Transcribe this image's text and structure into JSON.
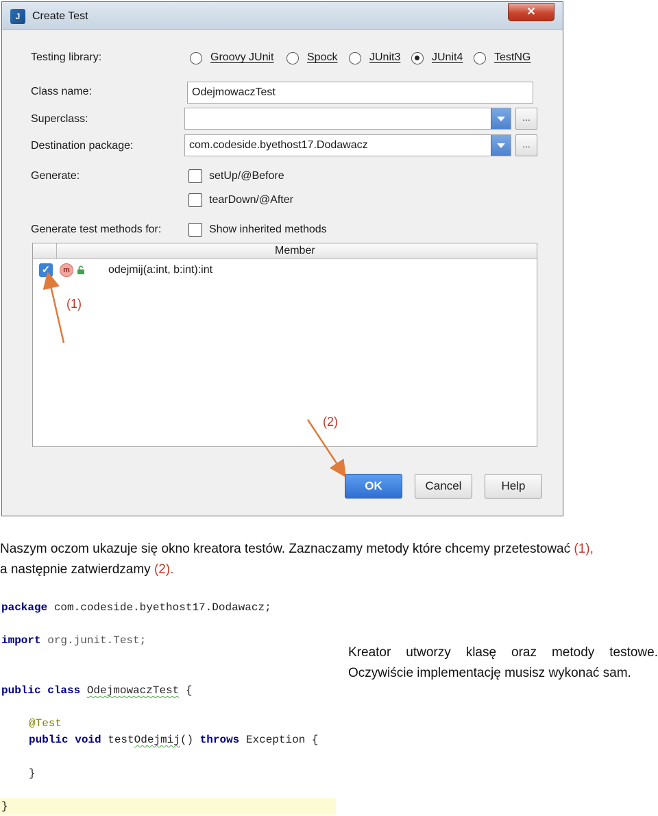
{
  "dialog": {
    "title": "Create Test",
    "close_label": "✕",
    "app_icon_label": "J",
    "testing_library": {
      "label": "Testing library:",
      "options": [
        {
          "label": "Groovy JUnit",
          "selected": false
        },
        {
          "label": "Spock",
          "selected": false
        },
        {
          "label": "JUnit3",
          "selected": false
        },
        {
          "label": "JUnit4",
          "selected": true
        },
        {
          "label": "TestNG",
          "selected": false
        }
      ]
    },
    "class_name": {
      "label": "Class name:",
      "value": "OdejmowaczTest"
    },
    "superclass": {
      "label": "Superclass:",
      "value": ""
    },
    "destination_package": {
      "label": "Destination package:",
      "value": "com.codeside.byethost17.Dodawacz"
    },
    "ellipsis_label": "...",
    "generate": {
      "label": "Generate:",
      "options": [
        {
          "label": "setUp/@Before",
          "checked": false
        },
        {
          "label": "tearDown/@After",
          "checked": false
        }
      ]
    },
    "generate_methods_for": {
      "label": "Generate test methods for:",
      "show_inherited_label": "Show inherited methods",
      "checked": false
    },
    "table": {
      "column_header": "Member",
      "rows": [
        {
          "checked": true,
          "icon_label": "m",
          "member": "odejmij(a:int, b:int):int"
        }
      ]
    },
    "buttons": {
      "ok": "OK",
      "cancel": "Cancel",
      "help": "Help"
    },
    "annotations": {
      "one": "(1)",
      "two": "(2)"
    },
    "accent_color": "#2f6fd1",
    "annotation_color": "#c0392b"
  },
  "prose": {
    "line1_text": "Naszym oczom ukazuje się okno kreatora testów. Zaznaczamy metody które chcemy przetestować ",
    "line1_ref": "(1),",
    "line2_text": "a następnie zatwierdzamy ",
    "line2_ref": "(2)."
  },
  "code": {
    "pkg_kw": "package",
    "pkg_name": " com.codeside.byethost17.Dodawacz;",
    "import_kw": "import",
    "import_name": " org.junit.Test;",
    "class_kw": "public class",
    "class_name": "OdejmowaczTest",
    "class_brace": " {",
    "annotation": "@Test",
    "method_kw": "public void",
    "method_prefix": " test",
    "method_squiggle": "Odejmij",
    "method_suffix": "()",
    "throws_kw": "throws",
    "exception": " Exception {",
    "close_inner": "}",
    "close_outer": "}"
  },
  "side_text": "Kreator utworzy klasę oraz metody testowe. Oczywiście implementację musisz wykonać sam."
}
